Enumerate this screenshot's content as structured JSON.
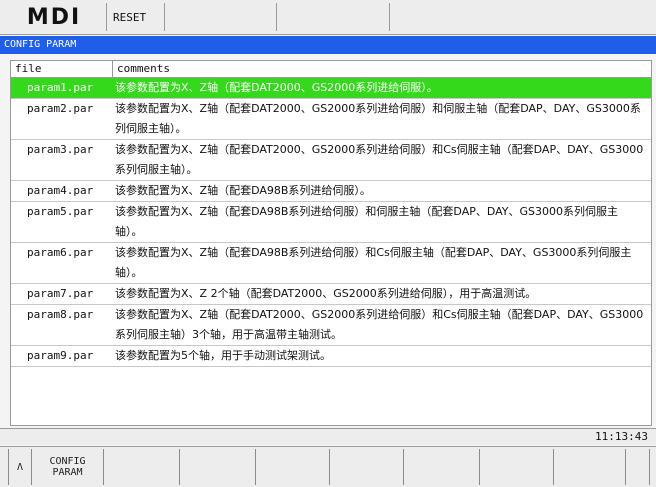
{
  "header": {
    "mode": "MDI",
    "status": "RESET"
  },
  "panel": {
    "title": "CONFIG PARAM"
  },
  "table": {
    "col_file": "file",
    "col_comments": "comments",
    "rows": [
      {
        "file": "param1.par",
        "comment": "该参数配置为X、Z轴（配套DAT2000、GS2000系列进给伺服）。"
      },
      {
        "file": "param2.par",
        "comment": "该参数配置为X、Z轴（配套DAT2000、GS2000系列进给伺服）和伺服主轴（配套DAP、DAY、GS3000系列伺服主轴）。"
      },
      {
        "file": "param3.par",
        "comment": "该参数配置为X、Z轴（配套DAT2000、GS2000系列进给伺服）和Cs伺服主轴（配套DAP、DAY、GS3000系列伺服主轴）。"
      },
      {
        "file": "param4.par",
        "comment": "该参数配置为X、Z轴（配套DA98B系列进给伺服）。"
      },
      {
        "file": "param5.par",
        "comment": "该参数配置为X、Z轴（配套DA98B系列进给伺服）和伺服主轴（配套DAP、DAY、GS3000系列伺服主轴）。"
      },
      {
        "file": "param6.par",
        "comment": "该参数配置为X、Z轴（配套DA98B系列进给伺服）和Cs伺服主轴（配套DAP、DAY、GS3000系列伺服主轴）。"
      },
      {
        "file": "param7.par",
        "comment": "该参数配置为X、Z 2个轴（配套DAT2000、GS2000系列进给伺服），用于高温测试。"
      },
      {
        "file": "param8.par",
        "comment": "该参数配置为X、Z轴（配套DAT2000、GS2000系列进给伺服）和Cs伺服主轴（配套DAP、DAY、GS3000系列伺服主轴）3个轴，用于高温带主轴测试。"
      },
      {
        "file": "param9.par",
        "comment": "该参数配置为5个轴，用于手动测试架测试。"
      }
    ]
  },
  "status": {
    "time": "11:13:43"
  },
  "softkeys": {
    "back_symbol": "Λ",
    "config_param": "CONFIG\nPARAM"
  },
  "colors": {
    "title_bar": "#1f5ee8",
    "selected_row": "#33d91a"
  }
}
